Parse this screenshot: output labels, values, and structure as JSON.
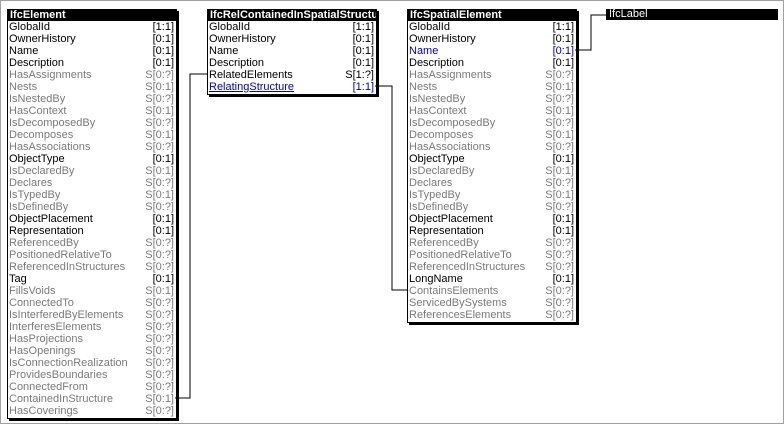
{
  "entities": [
    {
      "title": "IfcElement",
      "attributes": [
        {
          "name": "GlobalId",
          "card": "[1:1]",
          "kind": "req"
        },
        {
          "name": "OwnerHistory",
          "card": "[0:1]",
          "kind": "req"
        },
        {
          "name": "Name",
          "card": "[0:1]",
          "kind": "req"
        },
        {
          "name": "Description",
          "card": "[0:1]",
          "kind": "req"
        },
        {
          "name": "HasAssignments",
          "card": "S[0:?]",
          "kind": "inv"
        },
        {
          "name": "Nests",
          "card": "S[0:1]",
          "kind": "inv"
        },
        {
          "name": "IsNestedBy",
          "card": "S[0:?]",
          "kind": "inv"
        },
        {
          "name": "HasContext",
          "card": "S[0:1]",
          "kind": "inv"
        },
        {
          "name": "IsDecomposedBy",
          "card": "S[0:?]",
          "kind": "inv"
        },
        {
          "name": "Decomposes",
          "card": "S[0:1]",
          "kind": "inv"
        },
        {
          "name": "HasAssociations",
          "card": "S[0:?]",
          "kind": "inv"
        },
        {
          "name": "ObjectType",
          "card": "[0:1]",
          "kind": "req"
        },
        {
          "name": "IsDeclaredBy",
          "card": "S[0:1]",
          "kind": "inv"
        },
        {
          "name": "Declares",
          "card": "S[0:?]",
          "kind": "inv"
        },
        {
          "name": "IsTypedBy",
          "card": "S[0:1]",
          "kind": "inv"
        },
        {
          "name": "IsDefinedBy",
          "card": "S[0:?]",
          "kind": "inv"
        },
        {
          "name": "ObjectPlacement",
          "card": "[0:1]",
          "kind": "req"
        },
        {
          "name": "Representation",
          "card": "[0:1]",
          "kind": "req"
        },
        {
          "name": "ReferencedBy",
          "card": "S[0:?]",
          "kind": "inv"
        },
        {
          "name": "PositionedRelativeTo",
          "card": "S[0:?]",
          "kind": "inv"
        },
        {
          "name": "ReferencedInStructures",
          "card": "S[0:?]",
          "kind": "inv"
        },
        {
          "name": "Tag",
          "card": "[0:1]",
          "kind": "req"
        },
        {
          "name": "FillsVoids",
          "card": "S[0:1]",
          "kind": "inv"
        },
        {
          "name": "ConnectedTo",
          "card": "S[0:?]",
          "kind": "inv"
        },
        {
          "name": "IsInterferedByElements",
          "card": "S[0:?]",
          "kind": "inv"
        },
        {
          "name": "InterferesElements",
          "card": "S[0:?]",
          "kind": "inv"
        },
        {
          "name": "HasProjections",
          "card": "S[0:?]",
          "kind": "inv"
        },
        {
          "name": "HasOpenings",
          "card": "S[0:?]",
          "kind": "inv"
        },
        {
          "name": "IsConnectionRealization",
          "card": "S[0:?]",
          "kind": "inv"
        },
        {
          "name": "ProvidesBoundaries",
          "card": "S[0:?]",
          "kind": "inv"
        },
        {
          "name": "ConnectedFrom",
          "card": "S[0:?]",
          "kind": "inv"
        },
        {
          "name": "ContainedInStructure",
          "card": "S[0:1]",
          "kind": "inv"
        },
        {
          "name": "HasCoverings",
          "card": "S[0:?]",
          "kind": "inv"
        }
      ]
    },
    {
      "title": "IfcRelContainedInSpatialStructure",
      "attributes": [
        {
          "name": "GlobalId",
          "card": "[1:1]",
          "kind": "req"
        },
        {
          "name": "OwnerHistory",
          "card": "[0:1]",
          "kind": "req"
        },
        {
          "name": "Name",
          "card": "[0:1]",
          "kind": "req"
        },
        {
          "name": "Description",
          "card": "[0:1]",
          "kind": "req"
        },
        {
          "name": "RelatedElements",
          "card": "S[1:?]",
          "kind": "req"
        },
        {
          "name": "RelatingStructure",
          "card": "[1:1]",
          "kind": "sel"
        }
      ]
    },
    {
      "title": "IfcSpatialElement",
      "attributes": [
        {
          "name": "GlobalId",
          "card": "[1:1]",
          "kind": "req"
        },
        {
          "name": "OwnerHistory",
          "card": "[0:1]",
          "kind": "req"
        },
        {
          "name": "Name",
          "card": "[0:1]",
          "kind": "sel-plain"
        },
        {
          "name": "Description",
          "card": "[0:1]",
          "kind": "req"
        },
        {
          "name": "HasAssignments",
          "card": "S[0:?]",
          "kind": "inv"
        },
        {
          "name": "Nests",
          "card": "S[0:1]",
          "kind": "inv"
        },
        {
          "name": "IsNestedBy",
          "card": "S[0:?]",
          "kind": "inv"
        },
        {
          "name": "HasContext",
          "card": "S[0:1]",
          "kind": "inv"
        },
        {
          "name": "IsDecomposedBy",
          "card": "S[0:?]",
          "kind": "inv"
        },
        {
          "name": "Decomposes",
          "card": "S[0:1]",
          "kind": "inv"
        },
        {
          "name": "HasAssociations",
          "card": "S[0:?]",
          "kind": "inv"
        },
        {
          "name": "ObjectType",
          "card": "[0:1]",
          "kind": "req"
        },
        {
          "name": "IsDeclaredBy",
          "card": "S[0:1]",
          "kind": "inv"
        },
        {
          "name": "Declares",
          "card": "S[0:?]",
          "kind": "inv"
        },
        {
          "name": "IsTypedBy",
          "card": "S[0:1]",
          "kind": "inv"
        },
        {
          "name": "IsDefinedBy",
          "card": "S[0:?]",
          "kind": "inv"
        },
        {
          "name": "ObjectPlacement",
          "card": "[0:1]",
          "kind": "req"
        },
        {
          "name": "Representation",
          "card": "[0:1]",
          "kind": "req"
        },
        {
          "name": "ReferencedBy",
          "card": "S[0:?]",
          "kind": "inv"
        },
        {
          "name": "PositionedRelativeTo",
          "card": "S[0:?]",
          "kind": "inv"
        },
        {
          "name": "ReferencedInStructures",
          "card": "S[0:?]",
          "kind": "inv"
        },
        {
          "name": "LongName",
          "card": "[0:1]",
          "kind": "req"
        },
        {
          "name": "ContainsElements",
          "card": "S[0:?]",
          "kind": "inv"
        },
        {
          "name": "ServicedBySystems",
          "card": "S[0:?]",
          "kind": "inv"
        },
        {
          "name": "ReferencesElements",
          "card": "S[0:?]",
          "kind": "inv"
        }
      ]
    }
  ],
  "label_type": "IfcLabel",
  "colors": {
    "required": "#000000",
    "inverse": "#7a7a7a",
    "selected": "#0000c0",
    "header_bg": "#000000",
    "header_fg": "#ffffff"
  }
}
